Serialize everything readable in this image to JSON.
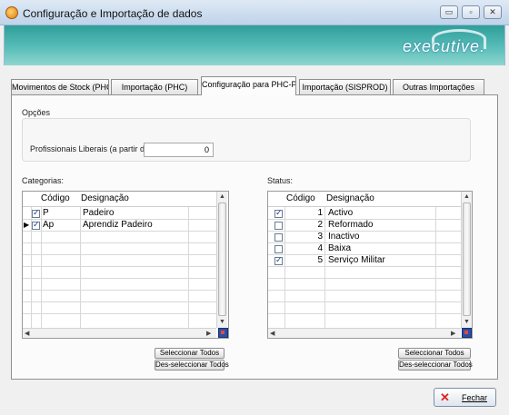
{
  "window": {
    "title": "Configuração e Importação de dados",
    "minimize": "▭",
    "maximize": "▫",
    "close": "✕"
  },
  "banner": {
    "logo": "executive."
  },
  "tabs": [
    {
      "label": "Movimentos de Stock (PHC)",
      "active": false
    },
    {
      "label": "Importação (PHC)",
      "active": false
    },
    {
      "label": "Configuração para PHC-Pes",
      "active": true
    },
    {
      "label": "Importação (SISPROD)",
      "active": false
    },
    {
      "label": "Outras Importações",
      "active": false
    }
  ],
  "options": {
    "heading": "Opções",
    "liberais_label": "Profissionais Liberais (a partir de):",
    "liberais_value": "0"
  },
  "categorias": {
    "heading": "Categorias:",
    "columns": {
      "codigo": "Código",
      "designacao": "Designação"
    },
    "rows": [
      {
        "checked": true,
        "codigo": "P",
        "designacao": "Padeiro",
        "current": false
      },
      {
        "checked": true,
        "codigo": "Ap",
        "designacao": "Aprendiz Padeiro",
        "current": true
      }
    ],
    "select_all": "Seleccionar Todos",
    "deselect_all": "Des-seleccionar Todos"
  },
  "status": {
    "heading": "Status:",
    "columns": {
      "codigo": "Código",
      "designacao": "Designação"
    },
    "rows": [
      {
        "checked": true,
        "codigo": "1",
        "designacao": "Activo"
      },
      {
        "checked": false,
        "codigo": "2",
        "designacao": "Reformado"
      },
      {
        "checked": false,
        "codigo": "3",
        "designacao": "Inactivo"
      },
      {
        "checked": false,
        "codigo": "4",
        "designacao": "Baixa"
      },
      {
        "checked": true,
        "codigo": "5",
        "designacao": "Serviço Militar"
      }
    ],
    "select_all": "Seleccionar Todos",
    "deselect_all": "Des-seleccionar Todos"
  },
  "footer": {
    "close_label": "Fechar",
    "close_icon": "✕"
  }
}
